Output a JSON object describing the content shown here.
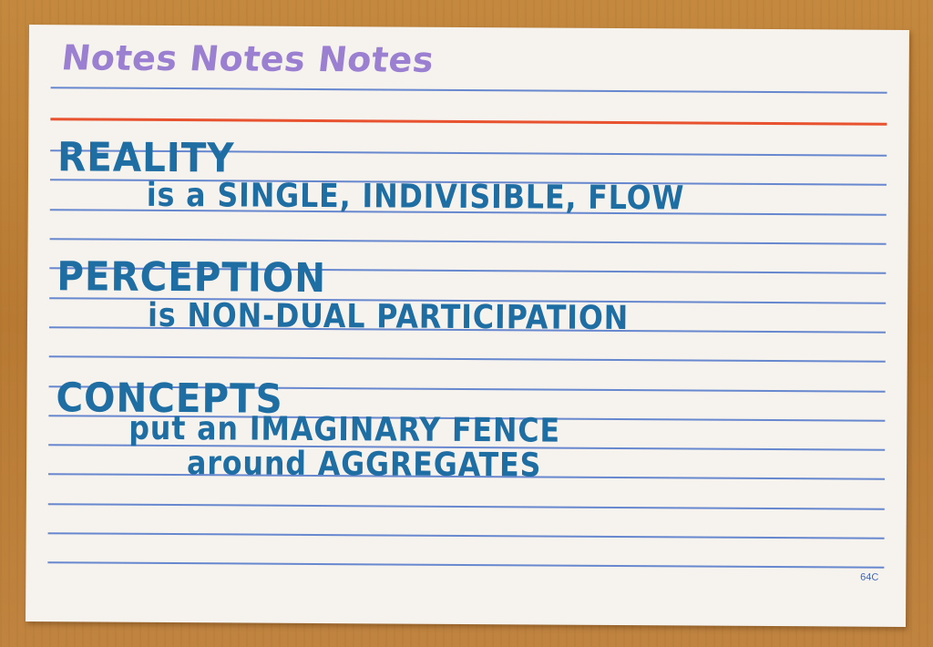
{
  "scene": {
    "background": "wooden-table",
    "object": "ruled-index-card"
  },
  "card": {
    "header": "Notes Notes Notes",
    "code": "64C",
    "line_color": "#4d74c9",
    "margin_line_color": "#e8522e",
    "header_ink_color": "#9b7fd1",
    "body_ink_color": "#1f6ea3"
  },
  "notes": [
    {
      "term": "REALITY",
      "phrase": "is a SINGLE, INDIVISIBLE, FLOW"
    },
    {
      "term": "PERCEPTION",
      "phrase": "is NON-DUAL PARTICIPATION"
    },
    {
      "term": "CONCEPTS",
      "phrase_line1": "put an IMAGINARY FENCE",
      "phrase_line2": "around AGGREGATES"
    }
  ]
}
